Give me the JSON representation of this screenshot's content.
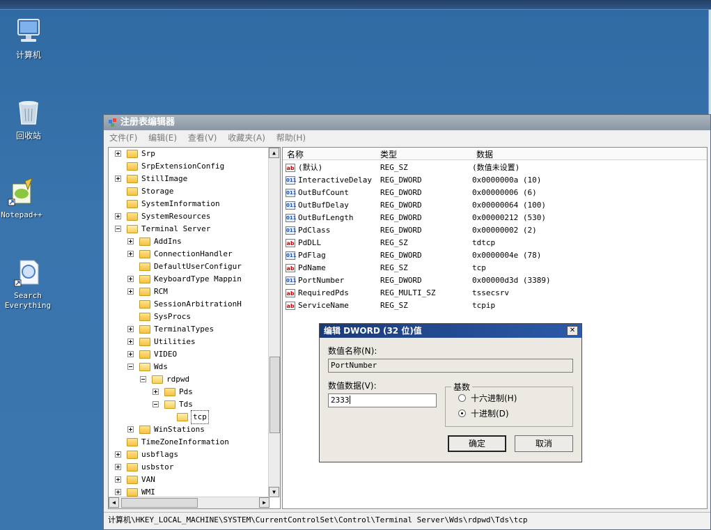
{
  "desktop": {
    "icons": [
      {
        "label": "计算机",
        "icon": "computer-icon"
      },
      {
        "label": "回收站",
        "icon": "recycle-bin-icon"
      },
      {
        "label": "Notepad++",
        "icon": "notepad-plus-plus-icon"
      },
      {
        "label": "Search Everything",
        "icon": "search-everything-icon"
      }
    ]
  },
  "regedit": {
    "title": "注册表编辑器",
    "menu": [
      "文件(F)",
      "编辑(E)",
      "查看(V)",
      "收藏夹(A)",
      "帮助(H)"
    ],
    "tree": [
      {
        "label": "Srp",
        "level": 1,
        "exp": "plus"
      },
      {
        "label": "SrpExtensionConfig",
        "level": 1,
        "exp": ""
      },
      {
        "label": "StillImage",
        "level": 1,
        "exp": "plus"
      },
      {
        "label": "Storage",
        "level": 1,
        "exp": ""
      },
      {
        "label": "SystemInformation",
        "level": 1,
        "exp": ""
      },
      {
        "label": "SystemResources",
        "level": 1,
        "exp": "plus"
      },
      {
        "label": "Terminal Server",
        "level": 1,
        "exp": "minus"
      },
      {
        "label": "AddIns",
        "level": 2,
        "exp": "plus"
      },
      {
        "label": "ConnectionHandler",
        "level": 2,
        "exp": "plus"
      },
      {
        "label": "DefaultUserConfigur",
        "level": 2,
        "exp": ""
      },
      {
        "label": "KeyboardType Mappin",
        "level": 2,
        "exp": "plus"
      },
      {
        "label": "RCM",
        "level": 2,
        "exp": "plus"
      },
      {
        "label": "SessionArbitrationH",
        "level": 2,
        "exp": ""
      },
      {
        "label": "SysProcs",
        "level": 2,
        "exp": ""
      },
      {
        "label": "TerminalTypes",
        "level": 2,
        "exp": "plus"
      },
      {
        "label": "Utilities",
        "level": 2,
        "exp": "plus"
      },
      {
        "label": "VIDEO",
        "level": 2,
        "exp": "plus"
      },
      {
        "label": "Wds",
        "level": 2,
        "exp": "minus"
      },
      {
        "label": "rdpwd",
        "level": 3,
        "exp": "minus"
      },
      {
        "label": "Pds",
        "level": 4,
        "exp": "plus"
      },
      {
        "label": "Tds",
        "level": 4,
        "exp": "minus"
      },
      {
        "label": "tcp",
        "level": 5,
        "exp": "",
        "selected": true
      },
      {
        "label": "WinStations",
        "level": 2,
        "exp": "plus"
      },
      {
        "label": "TimeZoneInformation",
        "level": 1,
        "exp": ""
      },
      {
        "label": "usbflags",
        "level": 1,
        "exp": "plus"
      },
      {
        "label": "usbstor",
        "level": 1,
        "exp": "plus"
      },
      {
        "label": "VAN",
        "level": 1,
        "exp": "plus"
      },
      {
        "label": "WMI",
        "level": 1,
        "exp": "plus"
      }
    ],
    "columns": {
      "name": "名称",
      "type": "类型",
      "data": "数据"
    },
    "values": [
      {
        "name": "(默认)",
        "type": "REG_SZ",
        "data": "(数值未设置)",
        "kind": "sz"
      },
      {
        "name": "InteractiveDelay",
        "type": "REG_DWORD",
        "data": "0x0000000a (10)",
        "kind": "dw"
      },
      {
        "name": "OutBufCount",
        "type": "REG_DWORD",
        "data": "0x00000006 (6)",
        "kind": "dw"
      },
      {
        "name": "OutBufDelay",
        "type": "REG_DWORD",
        "data": "0x00000064 (100)",
        "kind": "dw"
      },
      {
        "name": "OutBufLength",
        "type": "REG_DWORD",
        "data": "0x00000212 (530)",
        "kind": "dw"
      },
      {
        "name": "PdClass",
        "type": "REG_DWORD",
        "data": "0x00000002 (2)",
        "kind": "dw"
      },
      {
        "name": "PdDLL",
        "type": "REG_SZ",
        "data": "tdtcp",
        "kind": "sz"
      },
      {
        "name": "PdFlag",
        "type": "REG_DWORD",
        "data": "0x0000004e (78)",
        "kind": "dw"
      },
      {
        "name": "PdName",
        "type": "REG_SZ",
        "data": "tcp",
        "kind": "sz"
      },
      {
        "name": "PortNumber",
        "type": "REG_DWORD",
        "data": "0x00000d3d (3389)",
        "kind": "dw"
      },
      {
        "name": "RequiredPds",
        "type": "REG_MULTI_SZ",
        "data": "tssecsrv",
        "kind": "sz"
      },
      {
        "name": "ServiceName",
        "type": "REG_SZ",
        "data": "tcpip",
        "kind": "sz"
      }
    ],
    "status_path": "计算机\\HKEY_LOCAL_MACHINE\\SYSTEM\\CurrentControlSet\\Control\\Terminal Server\\Wds\\rdpwd\\Tds\\tcp"
  },
  "dialog": {
    "title": "编辑 DWORD (32 位)值",
    "close_label": "✕",
    "name_label": "数值名称(N):",
    "name_value": "PortNumber",
    "data_label": "数值数据(V):",
    "data_value": "2333",
    "base_label": "基数",
    "hex_label": "十六进制(H)",
    "dec_label": "十进制(D)",
    "selected_base": "decimal",
    "ok_label": "确定",
    "cancel_label": "取消"
  }
}
